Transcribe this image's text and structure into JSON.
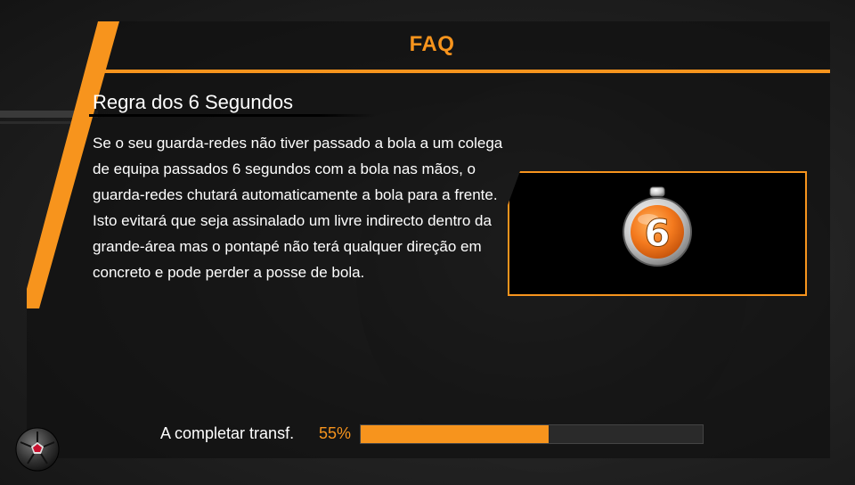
{
  "header": {
    "title": "FAQ"
  },
  "faq": {
    "section_title": "Regra dos 6 Segundos",
    "body": "Se o seu guarda-redes não tiver passado a bola a um colega de equipa passados 6 segundos com a bola nas mãos, o guarda-redes chutará automaticamente a bola para a frente. Isto evitará que seja assinalado um livre indirecto dentro da grande-área mas o pontapé não terá qualquer direção em concreto e pode perder a posse de bola.",
    "image_icon": "stopwatch-6-icon",
    "stopwatch_number": "6"
  },
  "progress": {
    "label": "A completar transf.",
    "percent_text": "55%",
    "value": 0.55
  },
  "colors": {
    "accent": "#f7941d",
    "panel": "#111111",
    "text": "#ffffff"
  },
  "icons": {
    "corner": "soccer-ball-icon"
  }
}
